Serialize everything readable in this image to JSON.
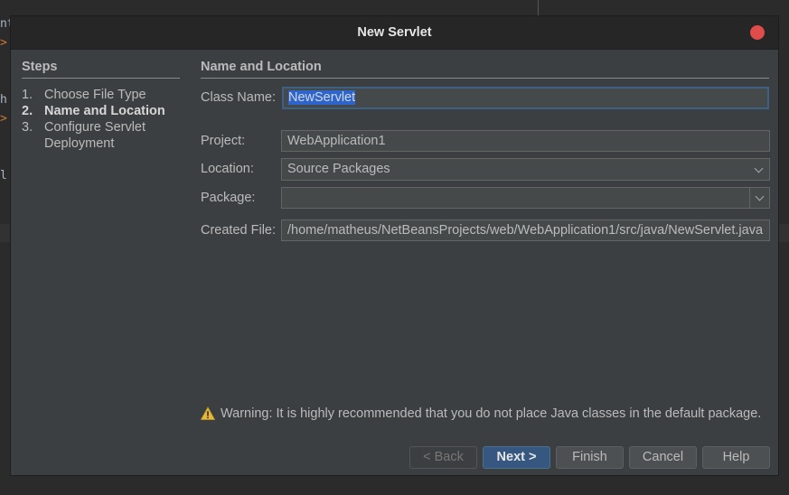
{
  "background": {
    "code_lines": [
      "nt",
      ">",
      "h",
      ">",
      "l"
    ]
  },
  "dialog": {
    "title": "New Servlet",
    "close_color": "#e04b4b"
  },
  "steps": {
    "heading": "Steps",
    "items": [
      {
        "num": "1.",
        "label": "Choose File Type",
        "active": false
      },
      {
        "num": "2.",
        "label": "Name and Location",
        "active": true
      },
      {
        "num": "3.",
        "label": "Configure Servlet",
        "active": false
      },
      {
        "num": "",
        "label": "Deployment",
        "active": false
      }
    ]
  },
  "panel": {
    "heading": "Name and Location",
    "class_name_label": "Class Name:",
    "class_name_value": "NewServlet",
    "project_label": "Project:",
    "project_value": "WebApplication1",
    "location_label": "Location:",
    "location_value": "Source Packages",
    "package_label": "Package:",
    "package_value": "",
    "created_file_label": "Created File:",
    "created_file_value": "/home/matheus/NetBeansProjects/web/WebApplication1/src/java/NewServlet.java"
  },
  "warning": {
    "icon": "warning-triangle-icon",
    "text": "Warning: It is highly recommended that you do not place Java classes in the default package."
  },
  "buttons": {
    "back": "< Back",
    "next": "Next >",
    "finish": "Finish",
    "cancel": "Cancel",
    "help": "Help"
  },
  "colors": {
    "accent": "#365880",
    "focus_border": "#3d6185",
    "selection": "#2f65ca"
  }
}
